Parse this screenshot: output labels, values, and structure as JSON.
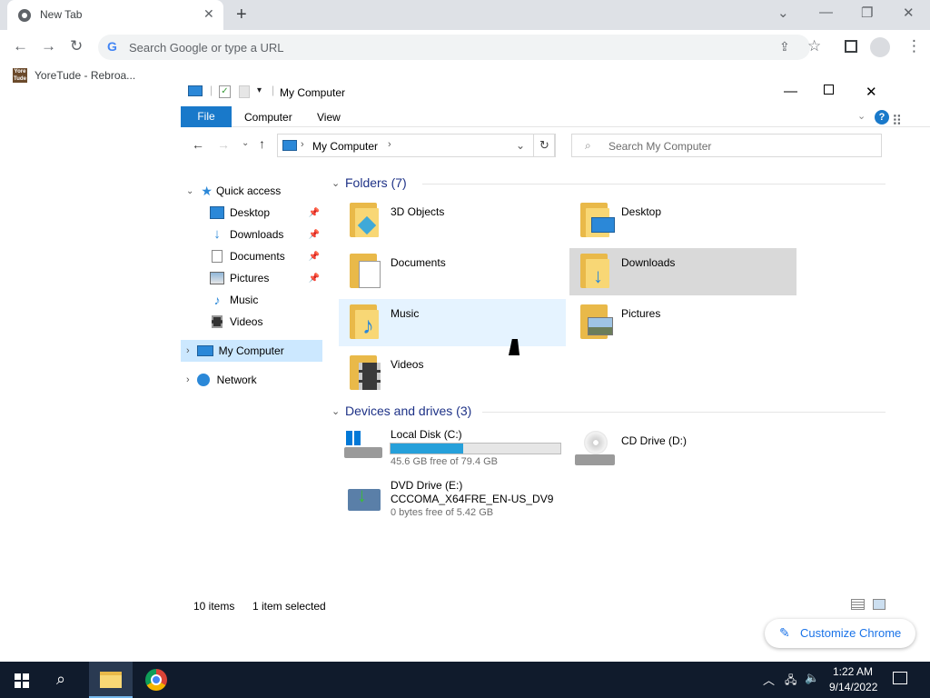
{
  "browser": {
    "tab_title": "New Tab",
    "omnibox_placeholder": "Search Google or type a URL",
    "bookmark_label": "YoreTude - Rebroa...",
    "bookmark_icon_text": "Yore Tude",
    "customize_label": "Customize Chrome"
  },
  "explorer": {
    "title": "My Computer",
    "ribbon": {
      "file": "File",
      "computer": "Computer",
      "view": "View",
      "help": "?"
    },
    "address": "My Computer",
    "search_placeholder": "Search My Computer",
    "nav": {
      "quick_access": "Quick access",
      "items": [
        {
          "label": "Desktop",
          "pinned": true
        },
        {
          "label": "Downloads",
          "pinned": true
        },
        {
          "label": "Documents",
          "pinned": true
        },
        {
          "label": "Pictures",
          "pinned": true
        },
        {
          "label": "Music",
          "pinned": false
        },
        {
          "label": "Videos",
          "pinned": false
        }
      ],
      "my_computer": "My Computer",
      "network": "Network"
    },
    "folders_header": "Folders (7)",
    "folders": [
      {
        "label": "3D Objects"
      },
      {
        "label": "Desktop"
      },
      {
        "label": "Documents"
      },
      {
        "label": "Downloads"
      },
      {
        "label": "Music"
      },
      {
        "label": "Pictures"
      },
      {
        "label": "Videos"
      }
    ],
    "devices_header": "Devices and drives (3)",
    "drives": {
      "c": {
        "name": "Local Disk (C:)",
        "free": "45.6 GB free of 79.4 GB",
        "used_fraction": 0.43
      },
      "d": {
        "name": "CD Drive (D:)"
      },
      "e": {
        "name": "DVD Drive (E:)",
        "label": "CCCOMA_X64FRE_EN-US_DV9",
        "free": "0 bytes free of 5.42 GB"
      }
    },
    "status": {
      "items": "10 items",
      "selected": "1 item selected"
    }
  },
  "taskbar": {
    "time": "1:22 AM",
    "date": "9/14/2022"
  },
  "colors": {
    "accent": "#1979ca",
    "selected": "#cce8ff",
    "drive_bar": "#26a0da"
  }
}
